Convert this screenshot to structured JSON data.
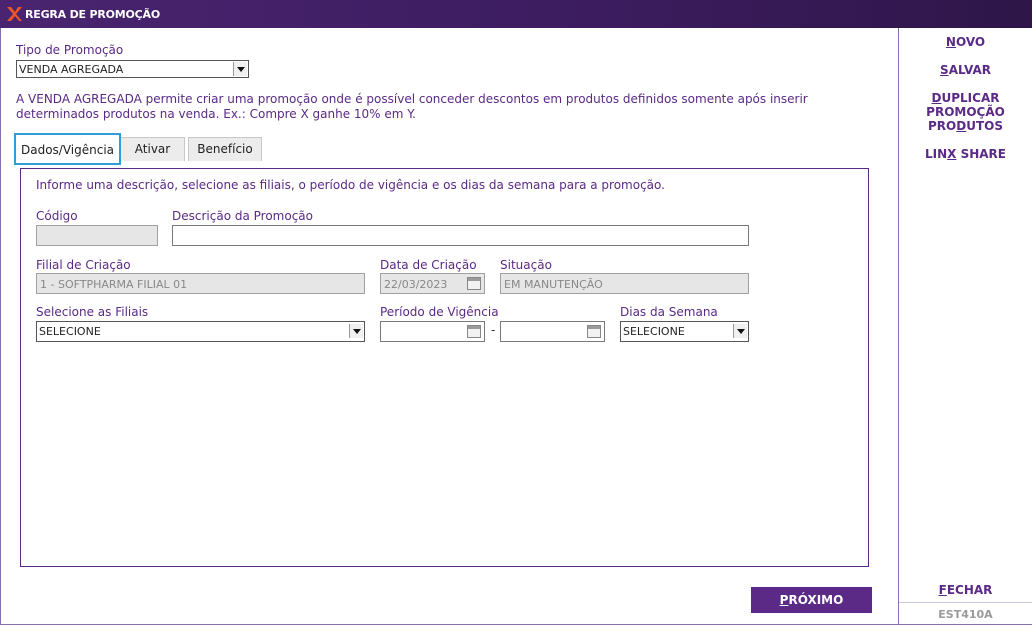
{
  "window": {
    "title": "REGRA DE PROMOÇÃO"
  },
  "promo_type": {
    "label": "Tipo de Promoção",
    "value": "VENDA AGREGADA"
  },
  "description": "A VENDA AGREGADA permite criar uma promoção onde é possível conceder descontos em produtos definidos somente após inserir determinados produtos na venda. Ex.: Compre X ganhe 10% em Y.",
  "tabs": [
    {
      "label": "Dados/Vigência",
      "active": true
    },
    {
      "label": "Ativar"
    },
    {
      "label": "Benefício"
    }
  ],
  "form": {
    "info": "Informe uma descrição, selecione as filiais, o período de vigência e os dias da semana para a promoção.",
    "codigo": {
      "label": "Código",
      "value": ""
    },
    "descricao": {
      "label": "Descrição da Promoção",
      "value": ""
    },
    "filial_criacao": {
      "label": "Filial de Criação",
      "value": "1 - SOFTPHARMA FILIAL 01"
    },
    "data_criacao": {
      "label": "Data de Criação",
      "value": "22/03/2023"
    },
    "situacao": {
      "label": "Situação",
      "value": "EM MANUTENÇÃO"
    },
    "filiais": {
      "label": "Selecione as Filiais",
      "value": "SELECIONE"
    },
    "periodo": {
      "label": "Período de Vigência",
      "start": "",
      "end": "",
      "separator": "-"
    },
    "dias": {
      "label": "Dias da Semana",
      "value": "SELECIONE"
    }
  },
  "side_menu": {
    "novo": {
      "pre": "",
      "u": "N",
      "post": "OVO"
    },
    "salvar": {
      "pre": "",
      "u": "S",
      "post": "ALVAR"
    },
    "duplicar": {
      "pre": "",
      "u": "D",
      "post": "UPLICAR PROMOÇÃO"
    },
    "produtos": {
      "pre": "PRO",
      "u": "D",
      "post": "UTOS"
    },
    "linx": {
      "pre": "LIN",
      "u": "X",
      "post": " SHARE"
    },
    "fechar": {
      "pre": "",
      "u": "F",
      "post": "ECHAR"
    },
    "screen_code": "EST410A"
  },
  "next_button": {
    "u": "P",
    "post": "RÓXIMO"
  },
  "colors": {
    "accent": "#5b2a86",
    "title_bar": "#3b1c5e",
    "tab_focus": "#2e9ed6"
  }
}
